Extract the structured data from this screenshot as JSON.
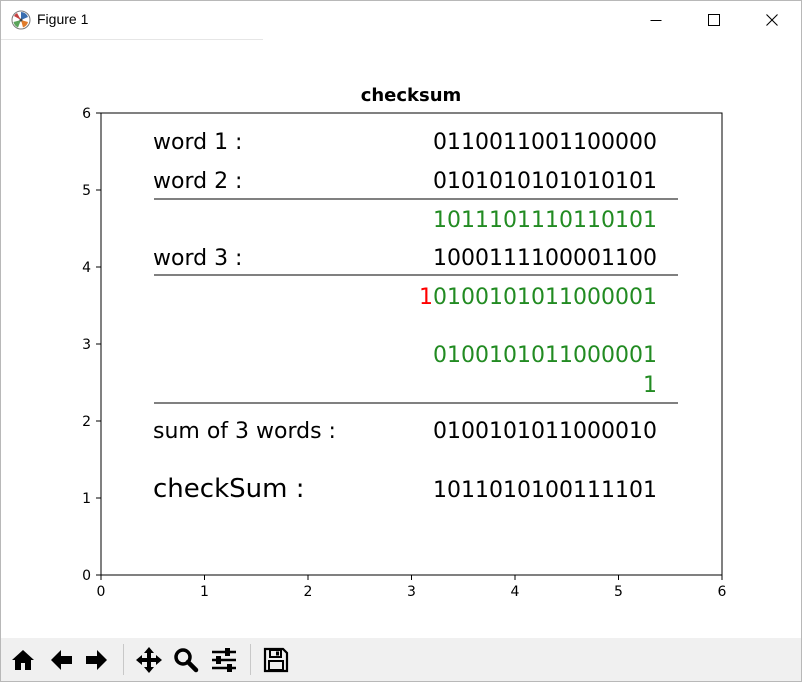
{
  "window": {
    "title": "Figure 1",
    "icons": {
      "app": "matplotlib-logo-icon",
      "minimize": "minimize-icon",
      "maximize": "maximize-icon",
      "close": "close-icon"
    }
  },
  "figure": {
    "title": "checksum",
    "x_ticks": [
      "0",
      "1",
      "2",
      "3",
      "4",
      "5",
      "6"
    ],
    "y_ticks": [
      "0",
      "1",
      "2",
      "3",
      "4",
      "5",
      "6"
    ],
    "xlim": [
      0,
      6
    ],
    "ylim": [
      0,
      6
    ],
    "labels": {
      "word1": "word 1 :",
      "word2": "word 2 :",
      "word3": "word 3 :",
      "sum": "sum of 3 words :",
      "checksum": "checkSum :"
    },
    "values": {
      "word1": "0110011001100000",
      "word2": "0101010101010101",
      "partial_sum": "1011101110110101",
      "word3": "1000111100001100",
      "overflow_carry": "1",
      "sum_with_carry": "0100101011000001",
      "wrapped": "0100101011000001",
      "carry_add": "1",
      "sum": "0100101011000010",
      "checksum": "1011010100111101"
    },
    "colors": {
      "result": "#228b22",
      "carry": "#ff0000",
      "text": "#000000"
    }
  },
  "toolbar": {
    "buttons": [
      {
        "name": "home-button",
        "icon": "home-icon"
      },
      {
        "name": "back-button",
        "icon": "arrow-left-icon"
      },
      {
        "name": "forward-button",
        "icon": "arrow-right-icon"
      },
      {
        "name": "pan-button",
        "icon": "move-icon"
      },
      {
        "name": "zoom-button",
        "icon": "magnifier-icon"
      },
      {
        "name": "configure-subplots-button",
        "icon": "sliders-icon"
      },
      {
        "name": "save-button",
        "icon": "floppy-disk-icon"
      }
    ]
  }
}
